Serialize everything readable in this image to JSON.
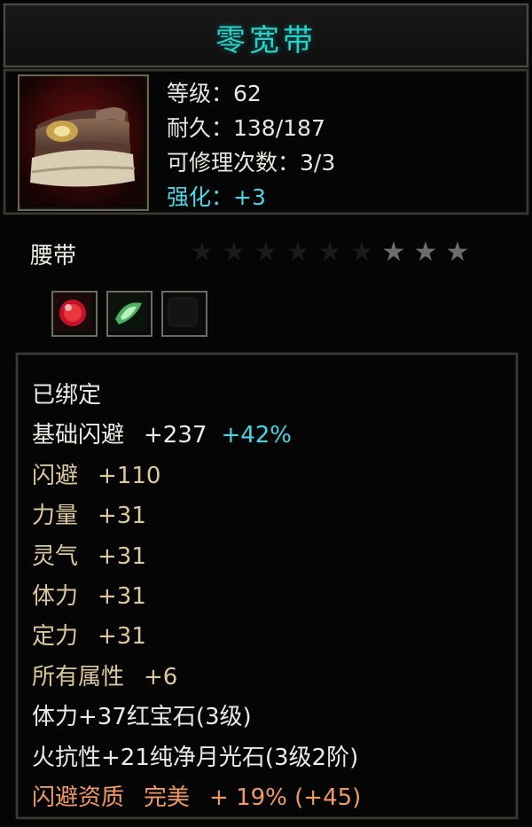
{
  "item": {
    "name": "零宽带",
    "type": "腰带",
    "stars": {
      "total": 9,
      "lit": 3
    }
  },
  "stats": {
    "level": "等级：62",
    "durability": "耐久：138/187",
    "repair": "可修理次数：3/3",
    "enhance": "强化：+3"
  },
  "sockets": [
    {
      "icon": "red-gem-icon"
    },
    {
      "icon": "green-moonstone-icon"
    },
    {
      "icon": "empty-socket-icon"
    }
  ],
  "attributes": {
    "bound": "已绑定",
    "base_dodge_label": "基础闪避",
    "base_dodge_value": "+237",
    "base_dodge_pct": "+42%",
    "dodge_label": "闪避",
    "dodge_value": "+110",
    "strength_label": "力量",
    "strength_value": "+31",
    "spirit_label": "灵气",
    "spirit_value": "+31",
    "vitality_label": "体力",
    "vitality_value": "+31",
    "focus_label": "定力",
    "focus_value": "+31",
    "all_label": "所有属性",
    "all_value": "+6",
    "gem1": "体力+37红宝石(3级)",
    "gem2": "火抗性+21纯净月光石(3级2阶)",
    "quality_label": "闪避资质",
    "quality_grade": "完美",
    "quality_value": "+ 19% (+45)"
  },
  "colors": {
    "title": "#2bd1c9",
    "white": "#ecebe4",
    "gold": "#dcc89a",
    "cyan": "#45d6e6",
    "orange": "#f09a63"
  }
}
